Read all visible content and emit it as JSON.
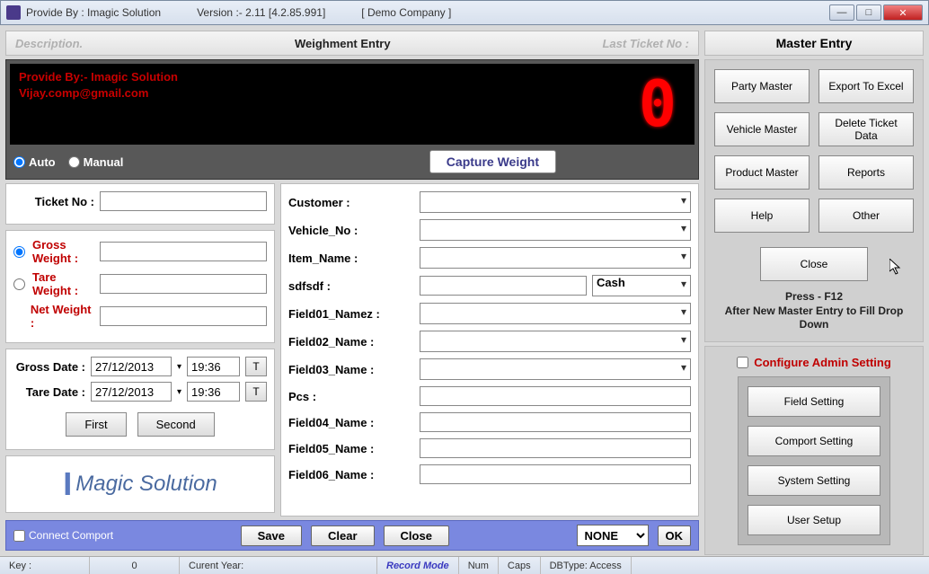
{
  "titlebar": {
    "provide": "Provide By : Imagic Solution",
    "version": "Version :- 2.11 [4.2.85.991]",
    "company": "[ Demo Company ]"
  },
  "header": {
    "desc": "Description.",
    "title": "Weighment Entry",
    "last": "Last Ticket No :"
  },
  "lcd": {
    "line1": "Provide By:- Imagic Solution",
    "line2": "Vijay.comp@gmail.com",
    "digit": "0"
  },
  "mode": {
    "auto": "Auto",
    "manual": "Manual",
    "capture": "Capture Weight"
  },
  "ticket": {
    "label": "Ticket No :",
    "value": ""
  },
  "weights": {
    "gross_label": "Gross Weight :",
    "gross_val": "",
    "tare_label": "Tare Weight  :",
    "tare_val": "",
    "net_label": "Net Weight :",
    "net_val": ""
  },
  "dates": {
    "gross_label": "Gross Date :",
    "gross_date": "27/12/2013",
    "gross_time": "19:36",
    "tare_label": "Tare Date :",
    "tare_date": "27/12/2013",
    "tare_time": "19:36",
    "t": "T"
  },
  "nav": {
    "first": "First",
    "second": "Second"
  },
  "logo": {
    "i": "I",
    "rest": "Magic  Solution"
  },
  "form": {
    "customer": "Customer :",
    "vehicle": "Vehicle_No :",
    "item": "Item_Name :",
    "sdf": "sdfsdf :",
    "cash": "Cash",
    "f1": "Field01_Namez :",
    "f2": "Field02_Name :",
    "f3": "Field03_Name :",
    "pcs": "Pcs :",
    "f4": "Field04_Name :",
    "f5": "Field05_Name :",
    "f6": "Field06_Name :"
  },
  "bottom": {
    "connect": "Connect Comport",
    "save": "Save",
    "clear": "Clear",
    "close": "Close",
    "none": "NONE",
    "ok": "OK"
  },
  "right": {
    "title": "Master Entry",
    "party": "Party Master",
    "export": "Export To Excel",
    "vehicle": "Vehicle Master",
    "delete": "Delete Ticket Data",
    "product": "Product Master",
    "reports": "Reports",
    "help": "Help",
    "other": "Other",
    "close": "Close",
    "hint1": "Press - F12",
    "hint2": "After New Master Entry to Fill Drop Down"
  },
  "admin": {
    "title": "Configure Admin Setting",
    "field": "Field Setting",
    "comport": "Comport Setting",
    "system": "System Setting",
    "user": "User Setup"
  },
  "status": {
    "key": "Key :",
    "keyval": "0",
    "year": "Curent Year:",
    "rec": "Record Mode",
    "num": "Num",
    "caps": "Caps",
    "db": "DBType: Access"
  }
}
